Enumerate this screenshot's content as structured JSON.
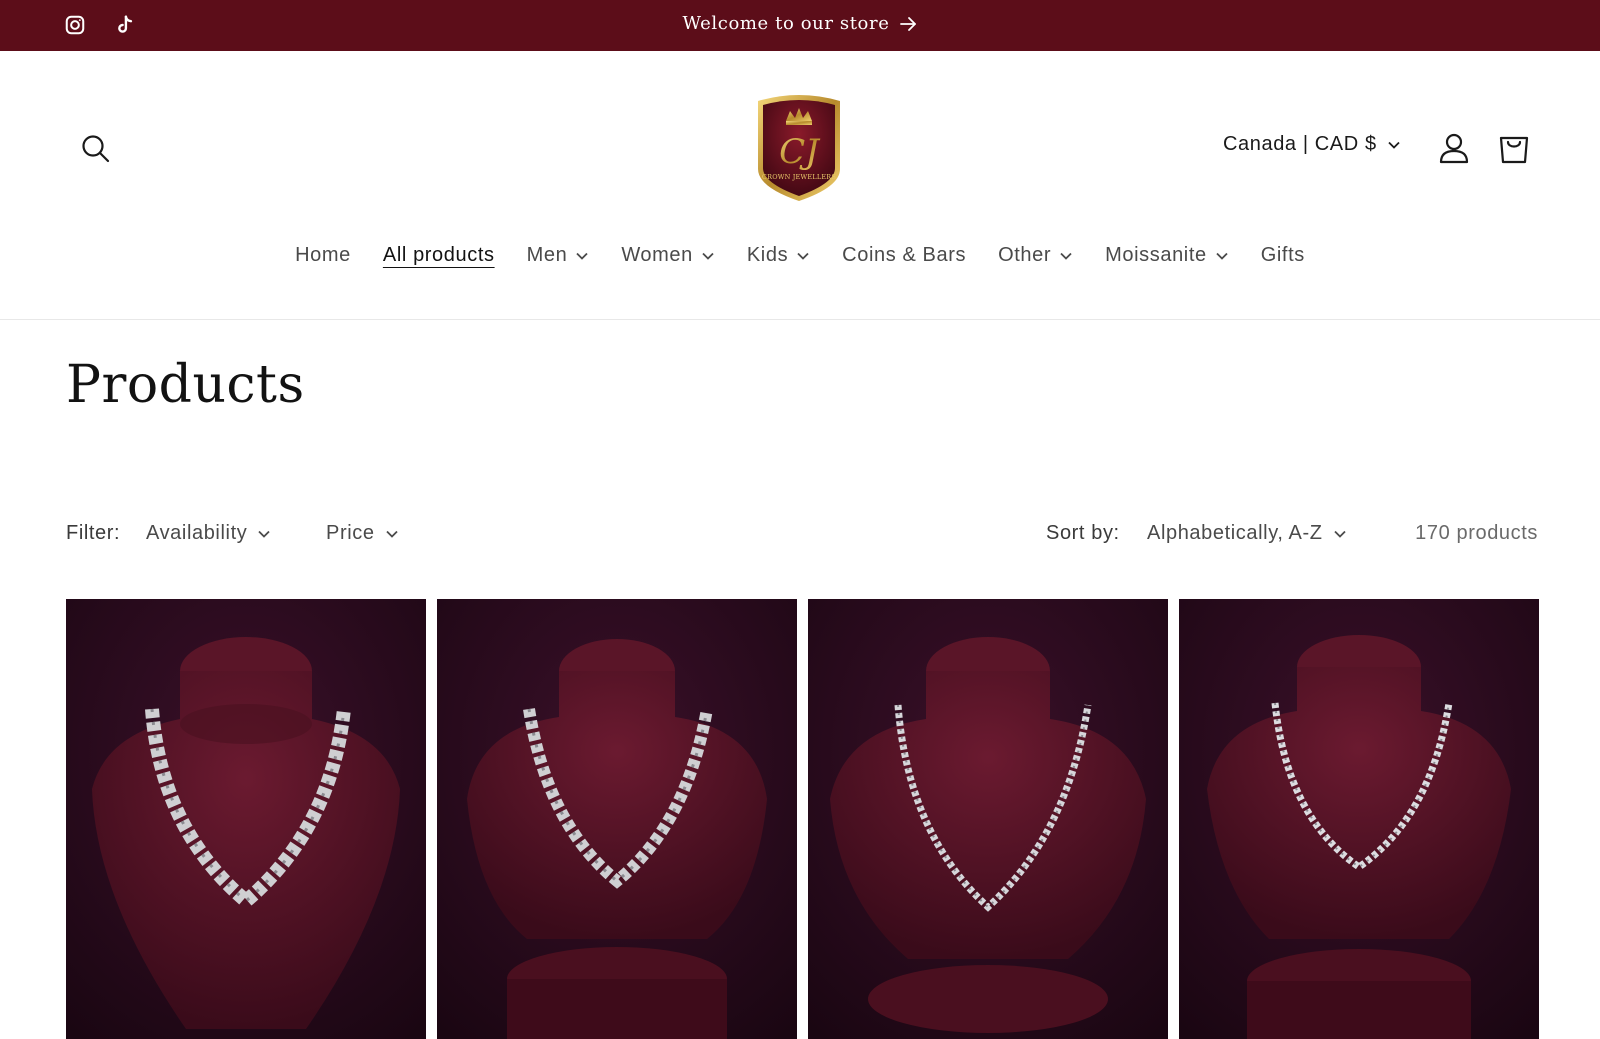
{
  "announcement": {
    "message": "Welcome to our store",
    "social": [
      "instagram-icon",
      "tiktok-icon"
    ],
    "background": "#5c0d19"
  },
  "header": {
    "logo_text": "CROWN JEWELLERS",
    "logo_monogram": "CJ",
    "locale": "Canada | CAD $",
    "icons": [
      "search-icon",
      "account-icon",
      "cart-icon"
    ]
  },
  "nav": {
    "items": [
      {
        "label": "Home",
        "dropdown": false,
        "active": false
      },
      {
        "label": "All products",
        "dropdown": false,
        "active": true
      },
      {
        "label": "Men",
        "dropdown": true,
        "active": false
      },
      {
        "label": "Women",
        "dropdown": true,
        "active": false
      },
      {
        "label": "Kids",
        "dropdown": true,
        "active": false
      },
      {
        "label": "Coins & Bars",
        "dropdown": false,
        "active": false
      },
      {
        "label": "Other",
        "dropdown": true,
        "active": false
      },
      {
        "label": "Moissanite",
        "dropdown": true,
        "active": false
      },
      {
        "label": "Gifts",
        "dropdown": false,
        "active": false
      }
    ]
  },
  "page": {
    "title": "Products"
  },
  "filters": {
    "label": "Filter:",
    "availability": "Availability",
    "price": "Price",
    "sort_label": "Sort by:",
    "sort_value": "Alphabetically, A-Z",
    "count": "170 products"
  },
  "products": [
    {
      "image": "silver-cuban-chain-on-bust",
      "chain_weight": "heavy"
    },
    {
      "image": "silver-cuban-chain-on-bust",
      "chain_weight": "heavy"
    },
    {
      "image": "silver-cuban-chain-on-bust",
      "chain_weight": "light"
    },
    {
      "image": "silver-cuban-chain-on-bust",
      "chain_weight": "light"
    }
  ]
}
